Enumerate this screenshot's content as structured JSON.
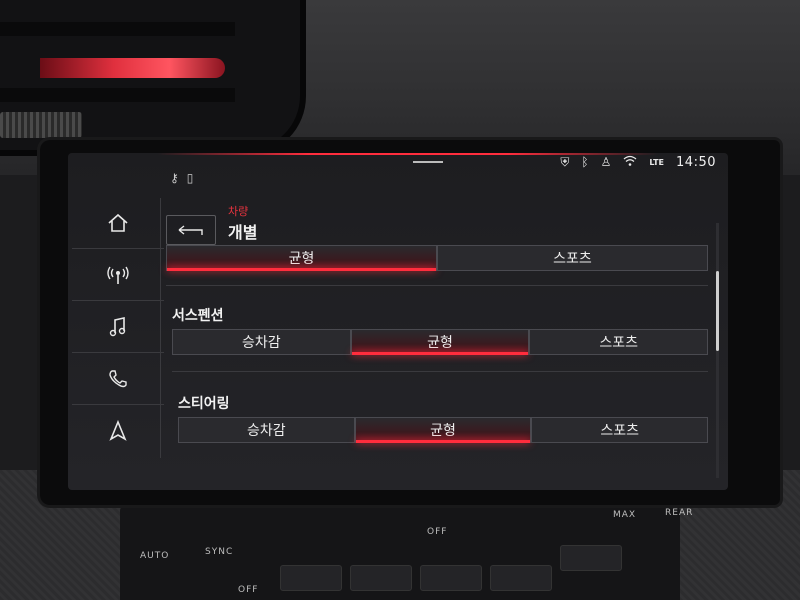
{
  "status": {
    "time": "14:50",
    "icons": [
      "lock-shield-icon",
      "bluetooth-icon",
      "person-icon",
      "wifi-icon",
      "lte-icon"
    ],
    "lte_label": "LTE"
  },
  "nav": {
    "items": [
      {
        "id": "home",
        "icon": "home-icon"
      },
      {
        "id": "radio",
        "icon": "radio-icon"
      },
      {
        "id": "media",
        "icon": "music-note-icon"
      },
      {
        "id": "phone",
        "icon": "phone-icon"
      },
      {
        "id": "navigation",
        "icon": "navigation-arrow-icon"
      }
    ]
  },
  "header": {
    "breadcrumb": "차량",
    "title": "개별"
  },
  "settings": {
    "top_row": {
      "options": [
        "균형",
        "스포츠"
      ],
      "selected": 0
    },
    "suspension": {
      "label": "서스펜션",
      "options": [
        "승차감",
        "균형",
        "스포츠"
      ],
      "selected": 1
    },
    "steering": {
      "label": "스티어링",
      "options": [
        "승차감",
        "균형",
        "스포츠"
      ],
      "selected": 1
    }
  },
  "climate": {
    "labels": {
      "auto": "AUTO",
      "sync": "SYNC",
      "off_left": "OFF",
      "off_right": "OFF",
      "max": "MAX",
      "rear": "REAR"
    }
  },
  "colors": {
    "accent": "#ff2d3d",
    "accent_text": "#e8333f",
    "screen_bg": "#1d1d20"
  }
}
